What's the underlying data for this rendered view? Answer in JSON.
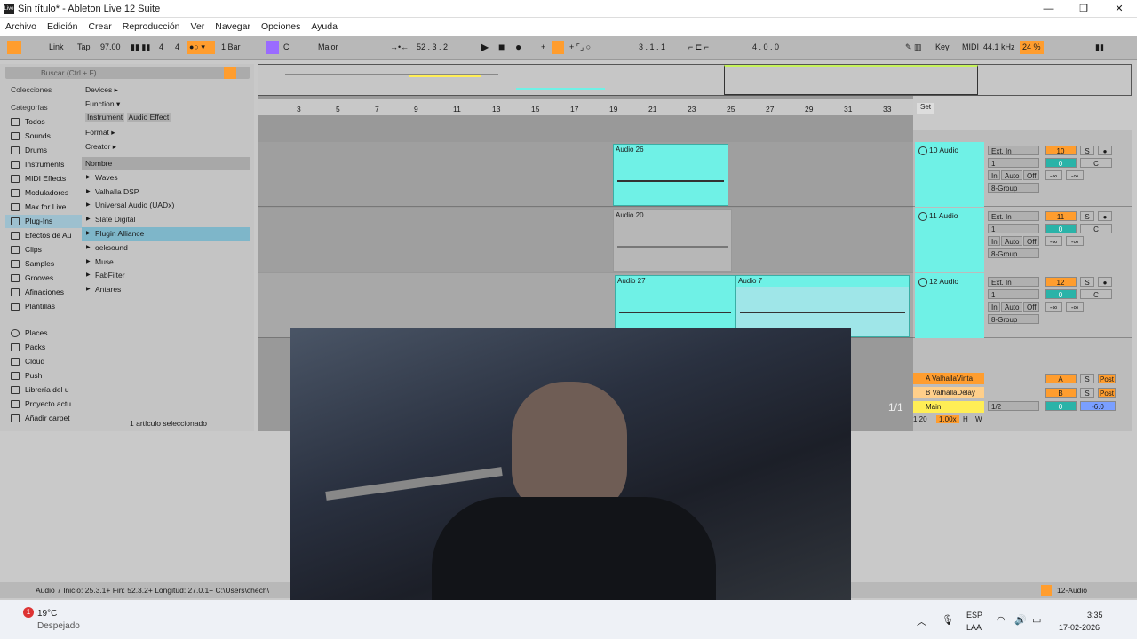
{
  "window": {
    "title": "Sin título* - Ableton Live 12 Suite",
    "app_icon": "Live"
  },
  "menu": [
    "Archivo",
    "Edición",
    "Crear",
    "Reproducción",
    "Ver",
    "Navegar",
    "Opciones",
    "Ayuda"
  ],
  "transport": {
    "link": "Link",
    "tap": "Tap",
    "tempo": "97.00",
    "signature_num": "4",
    "signature_den": "4",
    "quantize": "1 Bar",
    "key": "C",
    "scale": "Major",
    "position": "52 .  3 .  2",
    "loop_start": "3 .  1 .  1",
    "loop_length": "4 .  0 .  0",
    "key_map": "Key",
    "midi_map": "MIDI",
    "sample_rate": "44.1 kHz",
    "cpu": "24 %"
  },
  "browser": {
    "search_placeholder": "Buscar (Ctrl + F)",
    "collections_header": "Colecciones",
    "categories_header": "Categorías",
    "categories": [
      "Todos",
      "Sounds",
      "Drums",
      "Instruments",
      "MIDI Effects",
      "Moduladores",
      "Max for Live",
      "Plug-Ins",
      "Efectos de Au",
      "Clips",
      "Samples",
      "Grooves",
      "Afinaciones",
      "Plantillas"
    ],
    "places_header": "Places",
    "places": [
      "Packs",
      "Cloud",
      "Push",
      "Librería del u",
      "Proyecto actu",
      "Añadir carpet"
    ],
    "filters": [
      "Devices ▸",
      "Function ▾",
      "Format ▸",
      "Creator ▸"
    ],
    "filter_tags": [
      "Instrument",
      "Audio Effect"
    ],
    "name_header": "Nombre",
    "items": [
      "Waves",
      "Valhalla DSP",
      "Universal Audio (UADx)",
      "Slate Digital",
      "Plugin Alliance",
      "oeksound",
      "Muse",
      "FabFilter",
      "Antares"
    ],
    "footer": "1 artículo seleccionado"
  },
  "ruler": [
    "3",
    "5",
    "7",
    "9",
    "11",
    "13",
    "15",
    "17",
    "19",
    "21",
    "23",
    "25",
    "27",
    "29",
    "31",
    "33"
  ],
  "clips": {
    "a26": "Audio 26",
    "a20": "Audio 20",
    "a27": "Audio 27",
    "a7": "Audio 7"
  },
  "mixer": {
    "set": "Set",
    "tracks": [
      {
        "name": "10 Audio",
        "num": "10"
      },
      {
        "name": "11 Audio",
        "num": "11"
      },
      {
        "name": "12 Audio",
        "num": "12"
      }
    ],
    "input": "Ext. In",
    "channel": "1",
    "in": "In",
    "auto": "Auto",
    "off": "Off",
    "group": "8-Group",
    "s": "S",
    "vol": "0",
    "pan": "C",
    "minus_inf": "-∞",
    "returns": [
      {
        "name": "A ValhallaVinta",
        "letter": "A"
      },
      {
        "name": "B ValhallaDelay",
        "letter": "B"
      }
    ],
    "post": "Post",
    "main": "Main",
    "main_out": "1/2",
    "main_vol": "0",
    "main_db": "-6.0",
    "fraction": "1/1",
    "zoom_time": "1:20",
    "speed": "1.00x",
    "h": "H",
    "w": "W"
  },
  "status": {
    "clip_info": "Audio 7  Inicio: 25.3.1+  Fin: 52.3.2+  Longitud: 27.0.1+  C:\\Users\\chech\\",
    "track": "12-Audio"
  },
  "taskbar": {
    "temp": "19°C",
    "weather": "Despejado",
    "lang1": "ESP",
    "lang2": "LAA",
    "time": "3:35",
    "date": "17-02-2026",
    "badge": "1"
  }
}
